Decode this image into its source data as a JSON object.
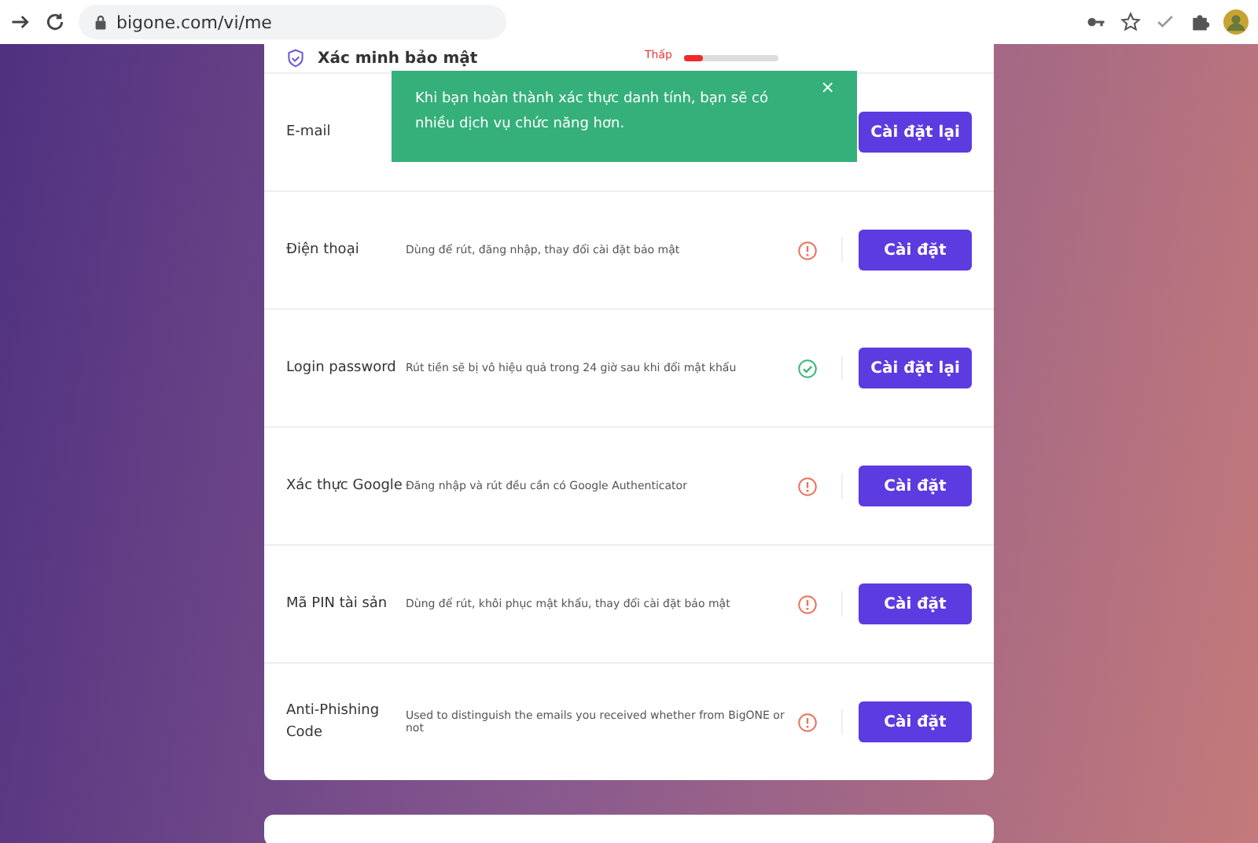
{
  "browser": {
    "url": "bigone.com/vi/me"
  },
  "security": {
    "title": "Xác minh bảo mật",
    "strength_label": "Thấp",
    "strength": {
      "level": 0.2
    },
    "rows": [
      {
        "label": "E-mail",
        "button": "Cài đặt lại"
      },
      {
        "label": "Điện thoại",
        "description": "Dùng để rút, đăng nhập, thay đổi cài đặt bảo mật",
        "verified": false,
        "button": "Cài đặt"
      },
      {
        "label": "Login password",
        "description": "Rút tiền sẽ bị vô hiệu quả trong 24 giờ sau khi đổi mật khẩu",
        "verified": true,
        "button": "Cài đặt lại"
      },
      {
        "label": "Xác thực Google",
        "description": "Đăng nhập và rút đều cần có Google Authenticator",
        "verified": false,
        "button": "Cài đặt"
      },
      {
        "label": "Mã PIN tài sản",
        "description": "Dùng để rút, khôi phục mật khẩu, thay đổi cài đặt bảo mật",
        "verified": false,
        "button": "Cài đặt"
      },
      {
        "label": "Anti-Phishing Code",
        "description": "Used to distinguish the emails you received whether from BigONE or not",
        "verified": false,
        "button": "Cài đặt"
      }
    ]
  },
  "toast": {
    "message": "Khi bạn hoàn thành xác thực danh tính, bạn sẽ có nhiều dịch vụ chức năng hơn.",
    "close": "×"
  }
}
